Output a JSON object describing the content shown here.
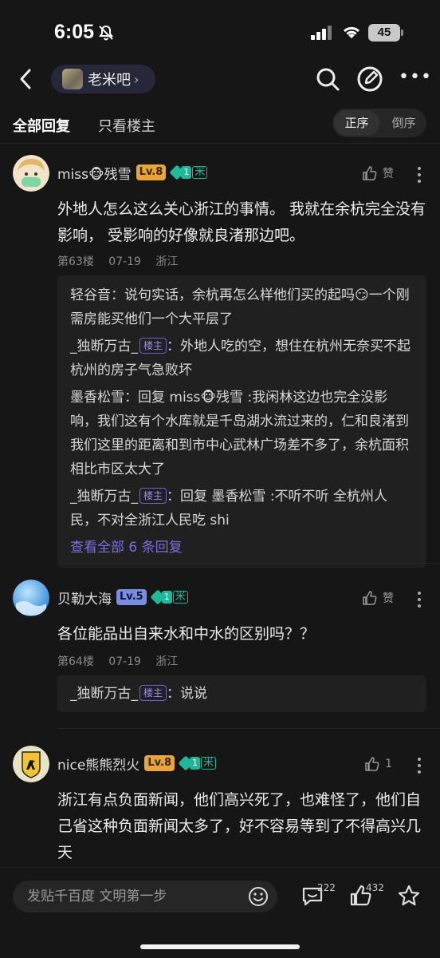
{
  "status": {
    "time": "6:05",
    "battery": "45"
  },
  "nav": {
    "forum_name": "老米吧",
    "chevron": "›"
  },
  "filter": {
    "all_replies": "全部回复",
    "only_op": "只看楼主",
    "order_asc": "正序",
    "order_desc": "倒序"
  },
  "posts": [
    {
      "username": "miss🐵残雪",
      "level": "Lv.8",
      "gem_num": "1",
      "gem_label": "米",
      "like_label": "赞",
      "content": "外地人怎么这么关心浙江的事情。 我就在余杭完全没有影响， 受影响的好像就良渚那边吧。",
      "floor": "第63楼",
      "date": "07-19",
      "location": "浙江",
      "replies": [
        {
          "who": "轻谷音",
          "text": "：说句实话，余杭再怎么样他们买的起吗😏一个刚需房能买他们一个大平层了"
        },
        {
          "who": "_独断万古_",
          "badge": "楼主",
          "text": "：外地人吃的空，想住在杭州无奈买不起杭州的房子气急败坏"
        },
        {
          "who": "墨香松雪",
          "text": "：回复 miss🐵残雪 :我闲林这边也完全没影响，我们这有个水库就是千岛湖水流过来的，仁和良渚到我们这里的距离和到市中心武林广场差不多了，余杭面积相比市区太大了"
        },
        {
          "who": "_独断万古_",
          "badge": "楼主",
          "text": "：回复 墨香松雪 :不听不听 全杭州人民，不对全浙江人民吃 shi"
        }
      ],
      "view_all": "查看全部 6 条回复"
    },
    {
      "username": "贝勒大海",
      "level": "Lv.5",
      "gem_num": "1",
      "gem_label": "米",
      "like_label": "赞",
      "content": "各位能品出自来水和中水的区别吗？？",
      "floor": "第64楼",
      "date": "07-19",
      "location": "浙江",
      "replies": [
        {
          "who": "_独断万古_",
          "badge": "楼主",
          "text": "：说说"
        }
      ]
    },
    {
      "username": "nice熊熊烈火",
      "level": "Lv.8",
      "gem_num": "1",
      "gem_label": "米",
      "like_label": "1",
      "content": "浙江有点负面新闻，他们高兴死了，也难怪了，他们自己省这种负面新闻太多了，好不容易等到了不得高兴几天"
    }
  ],
  "bottom": {
    "input_placeholder": "发贴千百度 文明第一步",
    "comment_count": "222",
    "like_count": "432"
  }
}
